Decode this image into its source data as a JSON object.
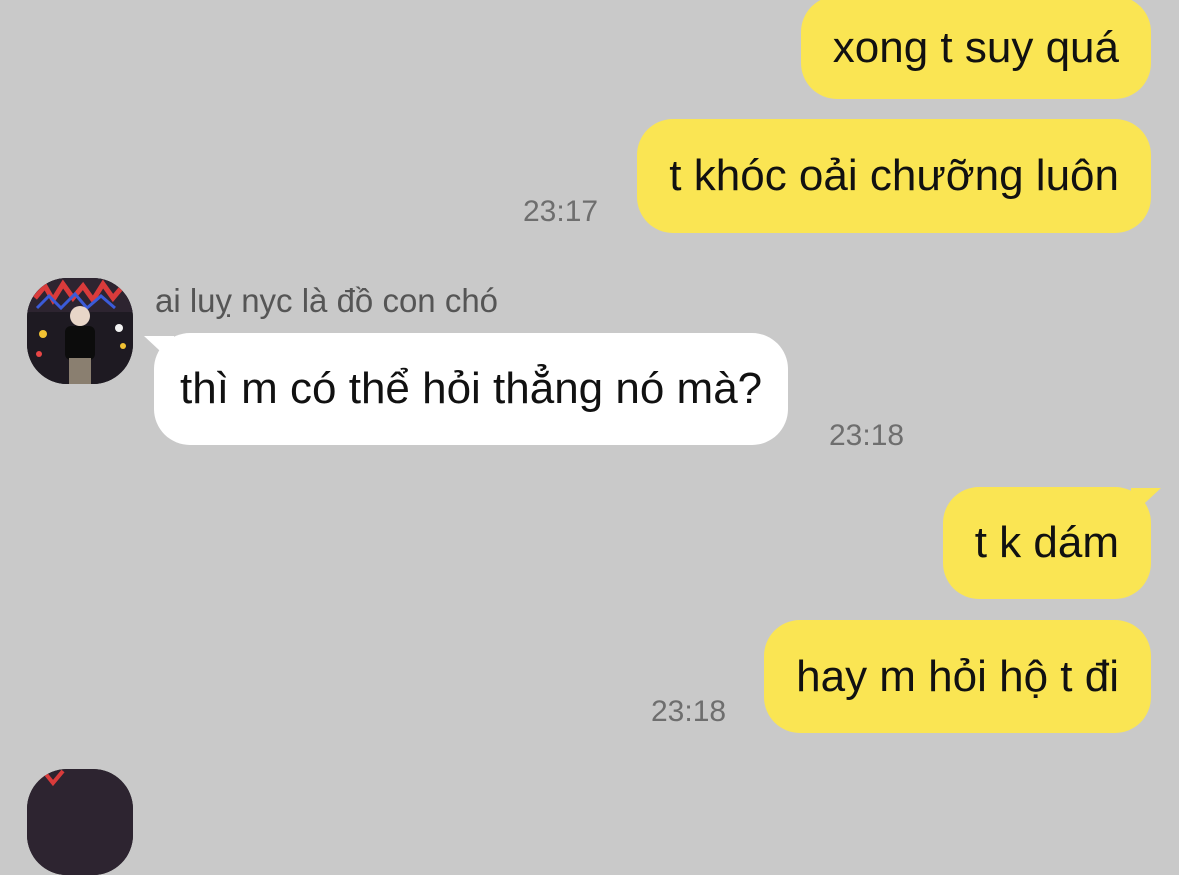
{
  "chat": {
    "background_color": "#c9c9c9",
    "sent_bubble_color": "#fae553",
    "received_bubble_color": "#ffffff",
    "messages": [
      {
        "direction": "sent",
        "text": "xong t suy quá"
      },
      {
        "direction": "sent",
        "text": "t khóc oải chưỡng luôn",
        "time": "23:17"
      },
      {
        "direction": "received",
        "sender": "ai luỵ nyc là đồ con chó",
        "text": "thì m có thể hỏi thẳng nó mà?",
        "time": "23:18"
      },
      {
        "direction": "sent",
        "text": "t k dám"
      },
      {
        "direction": "sent",
        "text": "hay m hỏi hộ t đi",
        "time": "23:18"
      }
    ]
  },
  "contact": {
    "avatar_icon": "avatar-photo-icon"
  }
}
